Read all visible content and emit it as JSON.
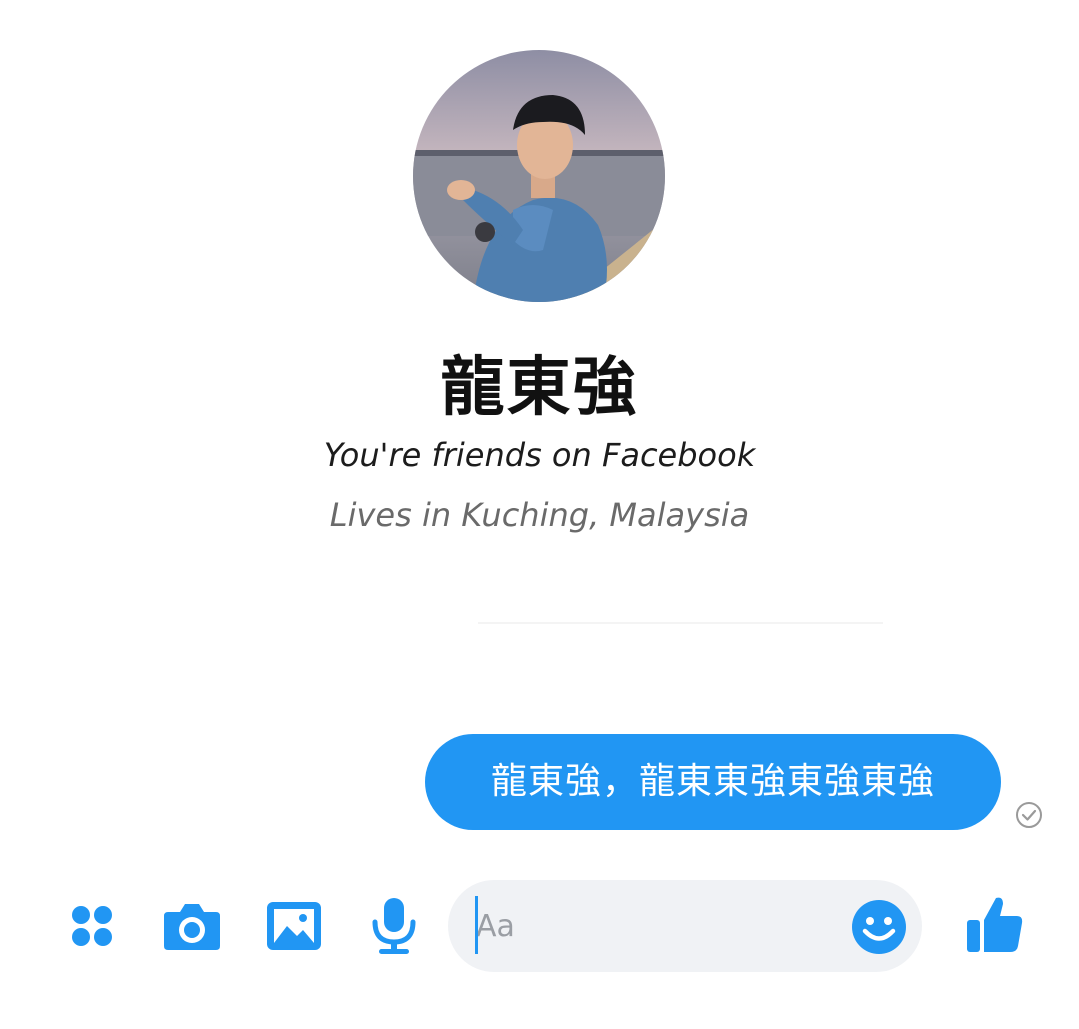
{
  "profile": {
    "name": "龍東強",
    "friendship_status": "You're friends on Facebook",
    "location": "Lives in Kuching, Malaysia"
  },
  "conversation": {
    "messages": [
      {
        "text": "龍東強，龍東東強東強東強",
        "sender": "me",
        "status": "sent"
      }
    ]
  },
  "composer": {
    "placeholder": "Aa",
    "icons": [
      "apps-grid-icon",
      "camera-icon",
      "image-icon",
      "microphone-icon",
      "smiley-icon",
      "thumbs-up-icon"
    ]
  },
  "colors": {
    "accent": "#2196f3",
    "input_background": "#f0f2f5",
    "secondary_text": "#6a6a6a"
  }
}
